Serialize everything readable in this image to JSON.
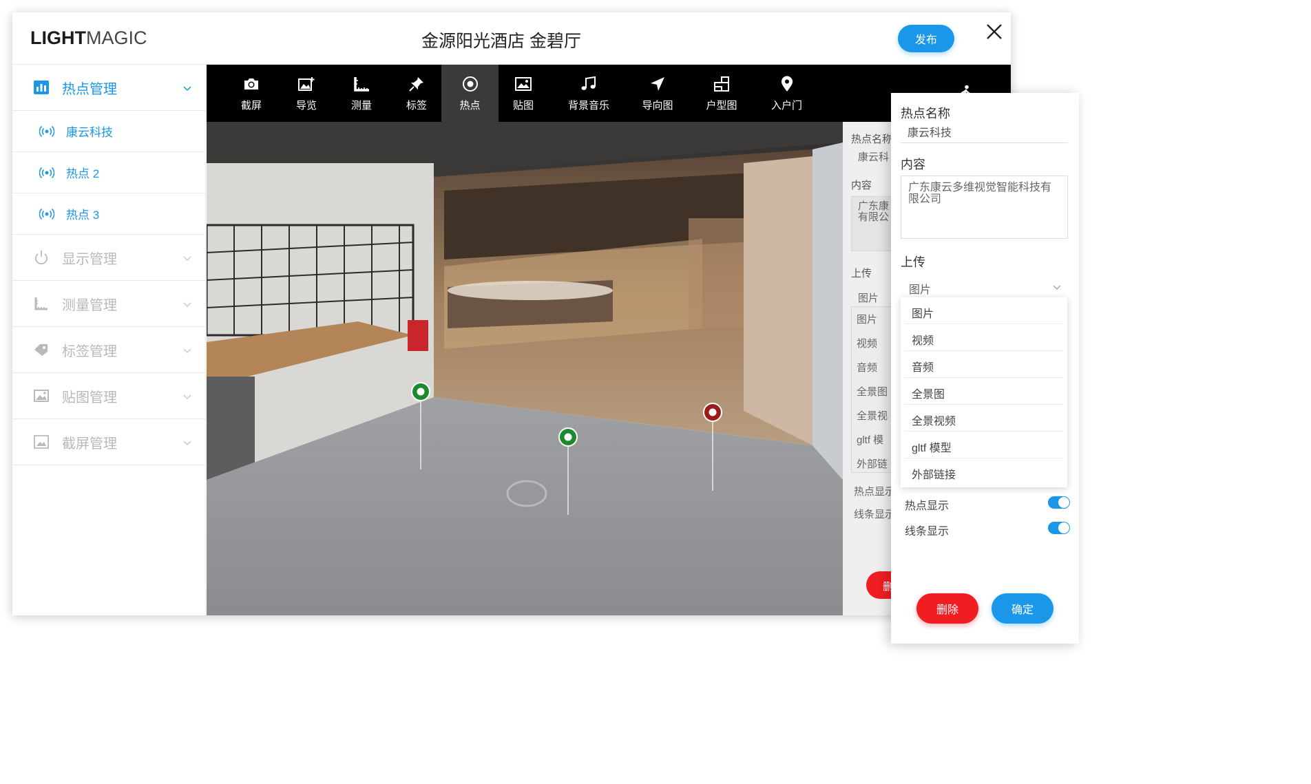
{
  "brand": {
    "logo_bold": "LIGHT",
    "logo_light": "MAGIC"
  },
  "header": {
    "title": "金源阳光酒店 金碧厅",
    "publish_label": "发布",
    "close_glyph": "✕"
  },
  "sidebar": {
    "groups": [
      {
        "label": "热点管理",
        "icon": "bar-chart-icon",
        "active": true,
        "items": [
          {
            "label": "康云科技"
          },
          {
            "label": "热点 2"
          },
          {
            "label": "热点 3"
          }
        ]
      },
      {
        "label": "显示管理",
        "icon": "power-icon"
      },
      {
        "label": "测量管理",
        "icon": "ruler-icon"
      },
      {
        "label": "标签管理",
        "icon": "tag-icon"
      },
      {
        "label": "贴图管理",
        "icon": "image-icon"
      },
      {
        "label": "截屏管理",
        "icon": "screenshot-icon"
      }
    ]
  },
  "toolbar": {
    "tools": [
      {
        "label": "截屏",
        "icon": "camera-icon"
      },
      {
        "label": "导览",
        "icon": "add-image-icon"
      },
      {
        "label": "测量",
        "icon": "ruler-icon"
      },
      {
        "label": "标签",
        "icon": "pin-icon"
      },
      {
        "label": "热点",
        "icon": "target-icon",
        "active": true
      },
      {
        "label": "贴图",
        "icon": "picture-icon"
      },
      {
        "label": "背景音乐",
        "icon": "music-icon"
      },
      {
        "label": "导向图",
        "icon": "navigation-icon"
      },
      {
        "label": "户型图",
        "icon": "floorplan-icon"
      },
      {
        "label": "入户门",
        "icon": "location-icon"
      }
    ],
    "walk_icon": "walking-person-icon"
  },
  "ghost_panel": {
    "name_label": "热点名称",
    "name_value": "康云科",
    "content_label": "内容",
    "content_value": "广东康\n有限公",
    "upload_label": "上传",
    "select_value": "图片",
    "options": [
      "图片",
      "视频",
      "音频",
      "全景图",
      "全景视",
      "gltf 模",
      "外部链"
    ],
    "hotspot_show": "热点显示",
    "line_show": "线条显示",
    "delete_partial": "删"
  },
  "panel": {
    "name_label": "热点名称",
    "name_value": "康云科技",
    "content_label": "内容",
    "content_value": "广东康云多维视觉智能科技有限公司",
    "upload_label": "上传",
    "select_value": "图片",
    "options": [
      "图片",
      "视频",
      "音频",
      "全景图",
      "全景视频",
      "gltf 模型",
      "外部链接"
    ],
    "hotspot_show_label": "热点显示",
    "line_show_label": "线条显示",
    "hotspot_show_on": true,
    "line_show_on": true,
    "delete_label": "删除",
    "confirm_label": "确定"
  },
  "colors": {
    "accent": "#1a97e8",
    "danger": "#f01e22",
    "hotspot_green": "#1e8a2e",
    "hotspot_red": "#9b1b1b"
  }
}
